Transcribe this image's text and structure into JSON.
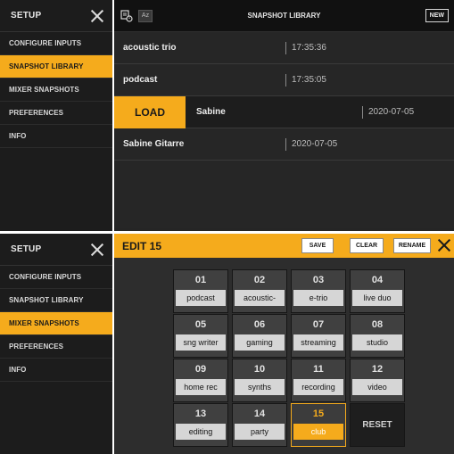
{
  "panel_top": {
    "sidebar": {
      "title": "SETUP",
      "items": [
        {
          "label": "CONFIGURE INPUTS",
          "active": false
        },
        {
          "label": "SNAPSHOT LIBRARY",
          "active": true
        },
        {
          "label": "MIXER SNAPSHOTS",
          "active": false
        },
        {
          "label": "PREFERENCES",
          "active": false
        },
        {
          "label": "INFO",
          "active": false
        }
      ]
    },
    "library": {
      "title": "SNAPSHOT LIBRARY",
      "sort_label": "Az",
      "new_label": "NEW",
      "load_label": "LOAD",
      "rows": [
        {
          "name": "acoustic trio",
          "time": "17:35:36"
        },
        {
          "name": "podcast",
          "time": "17:35:05"
        },
        {
          "name": "Sabine",
          "time": "2020-07-05"
        },
        {
          "name": "Sabine Gitarre",
          "time": "2020-07-05"
        }
      ]
    }
  },
  "panel_bottom": {
    "sidebar": {
      "title": "SETUP",
      "items": [
        {
          "label": "CONFIGURE INPUTS",
          "active": false
        },
        {
          "label": "SNAPSHOT LIBRARY",
          "active": false
        },
        {
          "label": "MIXER SNAPSHOTS",
          "active": true
        },
        {
          "label": "PREFERENCES",
          "active": false
        },
        {
          "label": "INFO",
          "active": false
        }
      ]
    },
    "edit": {
      "title": "EDIT 15",
      "save_label": "SAVE",
      "clear_label": "CLEAR",
      "rename_label": "RENAME",
      "reset_label": "RESET",
      "slots": [
        {
          "num": "01",
          "name": "podcast"
        },
        {
          "num": "02",
          "name": "acoustic-"
        },
        {
          "num": "03",
          "name": "e-trio"
        },
        {
          "num": "04",
          "name": "live duo"
        },
        {
          "num": "05",
          "name": "sng writer"
        },
        {
          "num": "06",
          "name": "gaming"
        },
        {
          "num": "07",
          "name": "streaming"
        },
        {
          "num": "08",
          "name": "studio"
        },
        {
          "num": "09",
          "name": "home rec"
        },
        {
          "num": "10",
          "name": "synths"
        },
        {
          "num": "11",
          "name": "recording"
        },
        {
          "num": "12",
          "name": "video"
        },
        {
          "num": "13",
          "name": "editing"
        },
        {
          "num": "14",
          "name": "party"
        },
        {
          "num": "15",
          "name": "club"
        }
      ],
      "active_slot": "15"
    }
  },
  "colors": {
    "accent": "#f5ab1c",
    "dark_bg": "#1c1c1c",
    "panel_bg": "#262626"
  }
}
